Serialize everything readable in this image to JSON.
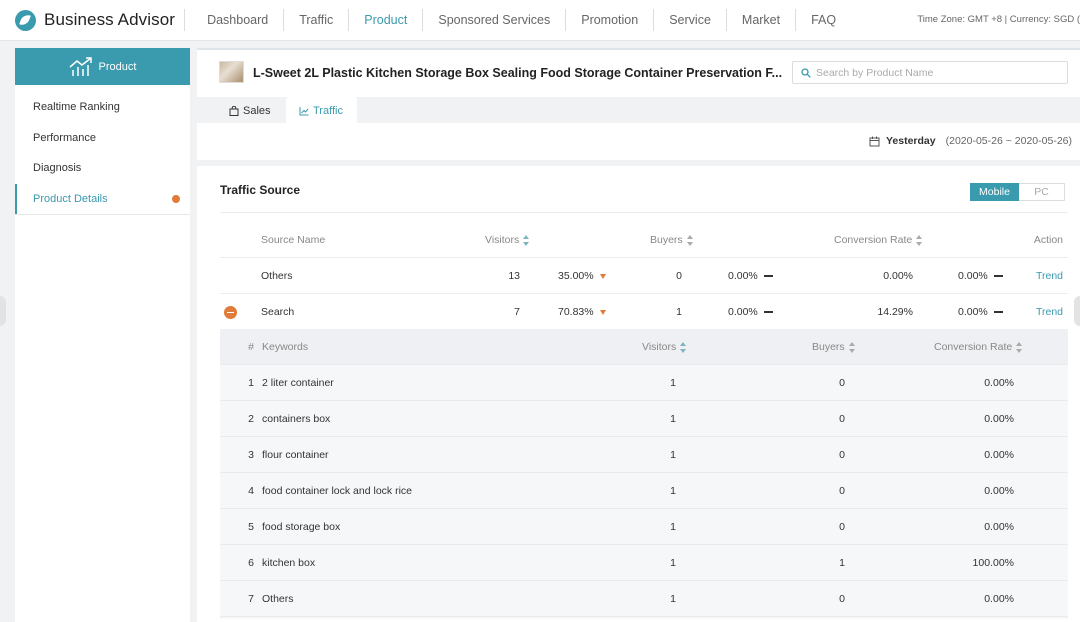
{
  "app": {
    "name": "Business Advisor"
  },
  "nav": [
    "Dashboard",
    "Traffic",
    "Product",
    "Sponsored Services",
    "Promotion",
    "Service",
    "Market",
    "FAQ"
  ],
  "nav_active": "Product",
  "timezone_text": "Time Zone: GMT +8 | Currency: SGD (",
  "sidebar": {
    "header": "Product",
    "items": [
      {
        "label": "Realtime Ranking"
      },
      {
        "label": "Performance"
      },
      {
        "label": "Diagnosis"
      },
      {
        "label": "Product Details"
      }
    ],
    "active": "Product Details"
  },
  "product": {
    "title": "L-Sweet 2L Plastic Kitchen Storage Box Sealing Food Storage Container Preservation F...",
    "search_placeholder": "Search by Product Name"
  },
  "tabs": {
    "sales": "Sales",
    "traffic": "Traffic",
    "active": "Traffic"
  },
  "date": {
    "label": "Yesterday",
    "range": "(2020-05-26 ~ 2020-05-26)"
  },
  "traffic_source": {
    "title": "Traffic Source",
    "toggle": {
      "mobile": "Mobile",
      "pc": "PC",
      "active": "Mobile"
    },
    "headers": {
      "source": "Source Name",
      "visitors": "Visitors",
      "buyers": "Buyers",
      "conversion": "Conversion Rate",
      "action": "Action"
    },
    "rows": [
      {
        "source": "Others",
        "visitors": "13",
        "visitors_pct": "35.00%",
        "buyers": "0",
        "buyers_pct": "0.00%",
        "conversion": "0.00%",
        "conversion_pct": "0.00%",
        "action": "Trend",
        "expanded": false
      },
      {
        "source": "Search",
        "visitors": "7",
        "visitors_pct": "70.83%",
        "buyers": "1",
        "buyers_pct": "0.00%",
        "conversion": "14.29%",
        "conversion_pct": "0.00%",
        "action": "Trend",
        "expanded": true
      }
    ]
  },
  "keywords": {
    "headers": {
      "index": "#",
      "keyword": "Keywords",
      "visitors": "Visitors",
      "buyers": "Buyers",
      "conversion": "Conversion Rate"
    },
    "rows": [
      {
        "index": "1",
        "keyword": "2 liter container",
        "visitors": "1",
        "buyers": "0",
        "conversion": "0.00%"
      },
      {
        "index": "2",
        "keyword": "containers box",
        "visitors": "1",
        "buyers": "0",
        "conversion": "0.00%"
      },
      {
        "index": "3",
        "keyword": "flour container",
        "visitors": "1",
        "buyers": "0",
        "conversion": "0.00%"
      },
      {
        "index": "4",
        "keyword": "food container lock and lock rice",
        "visitors": "1",
        "buyers": "0",
        "conversion": "0.00%"
      },
      {
        "index": "5",
        "keyword": "food storage box",
        "visitors": "1",
        "buyers": "0",
        "conversion": "0.00%"
      },
      {
        "index": "6",
        "keyword": "kitchen box",
        "visitors": "1",
        "buyers": "1",
        "conversion": "100.00%"
      },
      {
        "index": "7",
        "keyword": "Others",
        "visitors": "1",
        "buyers": "0",
        "conversion": "0.00%"
      }
    ]
  },
  "colors": {
    "accent": "#3a9aae",
    "warning": "#e07b39"
  }
}
